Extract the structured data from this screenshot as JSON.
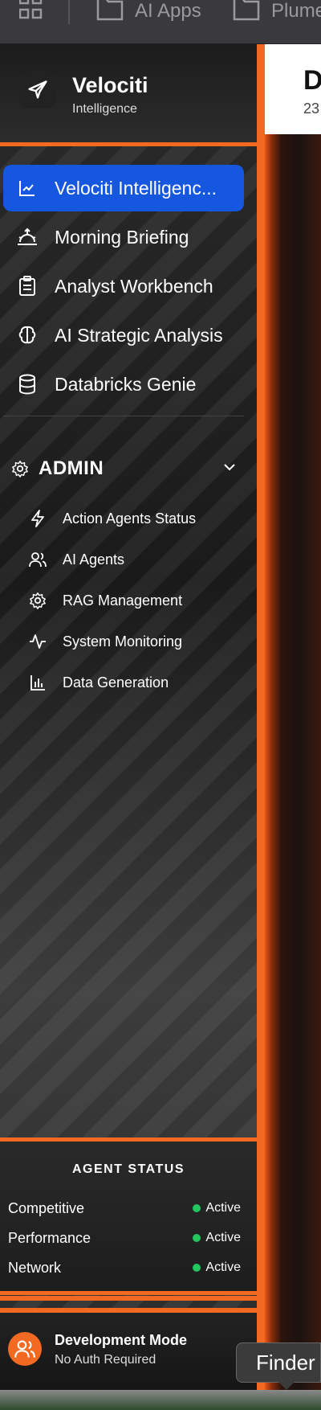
{
  "topbar": {
    "folders": [
      "AI Apps",
      "Plume"
    ]
  },
  "main": {
    "heading_fragment": "D",
    "subheading_fragment": "23"
  },
  "brand": {
    "name": "Velociti",
    "subtitle": "Intelligence"
  },
  "nav": {
    "items": [
      {
        "label": "Velociti Intelligenc...",
        "icon": "line-chart-icon",
        "active": true
      },
      {
        "label": "Morning Briefing",
        "icon": "sunrise-icon"
      },
      {
        "label": "Analyst Workbench",
        "icon": "clipboard-icon"
      },
      {
        "label": "AI Strategic Analysis",
        "icon": "brain-icon"
      },
      {
        "label": "Databricks Genie",
        "icon": "database-icon"
      }
    ]
  },
  "admin": {
    "label": "ADMIN",
    "icon": "gear-icon",
    "items": [
      {
        "label": "Action Agents Status",
        "icon": "lightning-icon"
      },
      {
        "label": "AI Agents",
        "icon": "users-icon"
      },
      {
        "label": "RAG Management",
        "icon": "cog-icon"
      },
      {
        "label": "System Monitoring",
        "icon": "activity-icon"
      },
      {
        "label": "Data Generation",
        "icon": "bar-chart-icon"
      }
    ]
  },
  "agent_status": {
    "title": "AGENT STATUS",
    "rows": [
      {
        "name": "Competitive",
        "state": "Active"
      },
      {
        "name": "Performance",
        "state": "Active"
      },
      {
        "name": "Network",
        "state": "Active"
      }
    ]
  },
  "devmode": {
    "title": "Development Mode",
    "subtitle": "No Auth Required"
  },
  "tooltip": {
    "label": "Finder"
  },
  "colors": {
    "accent": "#f26a22",
    "active_nav": "#1657e0",
    "status_green": "#22c55e"
  }
}
